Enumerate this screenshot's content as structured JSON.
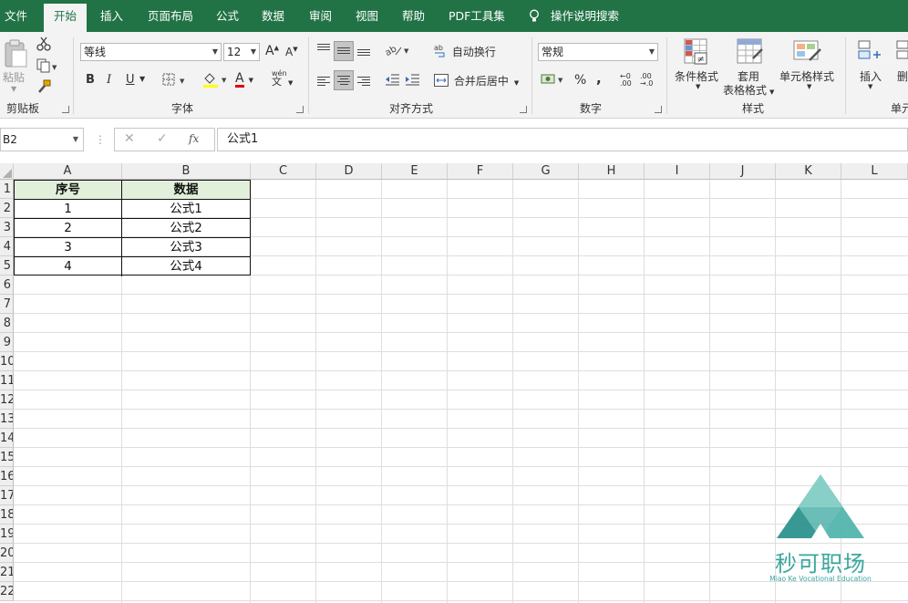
{
  "tabs": [
    "文件",
    "开始",
    "插入",
    "页面布局",
    "公式",
    "数据",
    "审阅",
    "视图",
    "帮助",
    "PDF工具集",
    "操作说明搜索"
  ],
  "ribbon": {
    "clipboard": {
      "paste": "粘贴",
      "label": "剪贴板"
    },
    "font": {
      "name": "等线",
      "size": "12",
      "grow": "A",
      "shrink": "A",
      "bold": "B",
      "italic": "I",
      "underline": "U",
      "font_color": "A",
      "phonetic": "wén",
      "label": "字体"
    },
    "align": {
      "wrap": "自动换行",
      "merge": "合并后居中",
      "label": "对齐方式"
    },
    "number": {
      "format": "常规",
      "percent": "%",
      "comma": ",",
      "label": "数字"
    },
    "styles": {
      "cond": "条件格式",
      "table1": "套用",
      "table2": "表格格式",
      "cell": "单元格样式",
      "label": "样式"
    },
    "cells": {
      "insert": "插入",
      "delete": "删",
      "label": "单元"
    }
  },
  "formula_bar": {
    "name_box": "B2",
    "fx": "fx",
    "formula": "公式1"
  },
  "columns": [
    "A",
    "B",
    "C",
    "D",
    "E",
    "F",
    "G",
    "H",
    "I",
    "J",
    "K",
    "L"
  ],
  "rows": [
    "1",
    "2",
    "3",
    "4",
    "5",
    "6",
    "7",
    "8",
    "9",
    "10",
    "11",
    "12",
    "13",
    "14",
    "15",
    "16",
    "17",
    "18",
    "19",
    "20",
    "21",
    "22"
  ],
  "table": {
    "header": [
      "序号",
      "数据"
    ],
    "rows": [
      [
        "1",
        "公式1"
      ],
      [
        "2",
        "公式2"
      ],
      [
        "3",
        "公式3"
      ],
      [
        "4",
        "公式4"
      ]
    ]
  },
  "watermark": {
    "name": "秒可职场",
    "sub": "Miao Ke Vocational Education"
  },
  "colors": {
    "accent": "#217346",
    "header_fill": "#e2efda"
  }
}
